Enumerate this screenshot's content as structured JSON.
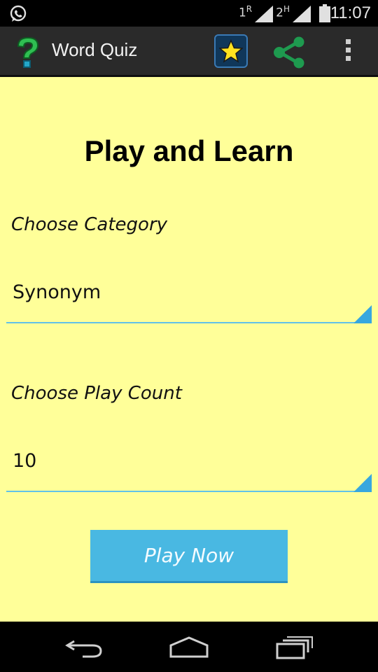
{
  "status_bar": {
    "time": "11:07",
    "sim1_label": "1",
    "sim1_sup": "R",
    "sim2_label": "2",
    "sim2_sup": "H"
  },
  "action_bar": {
    "title": "Word Quiz",
    "icons": [
      "question-mark-icon",
      "star-icon",
      "share-icon",
      "overflow-menu-icon"
    ]
  },
  "main": {
    "title": "Play and Learn",
    "category_label": "Choose Category",
    "category_value": "Synonym",
    "count_label": "Choose Play Count",
    "count_value": "10",
    "play_button": "Play Now"
  },
  "colors": {
    "background": "#ffff99",
    "accent": "#49b8e2",
    "share_green": "#1e9a4f",
    "action_bar": "#2a2a2a"
  },
  "nav_bar": {
    "icons": [
      "back-icon",
      "home-icon",
      "recents-icon"
    ]
  }
}
